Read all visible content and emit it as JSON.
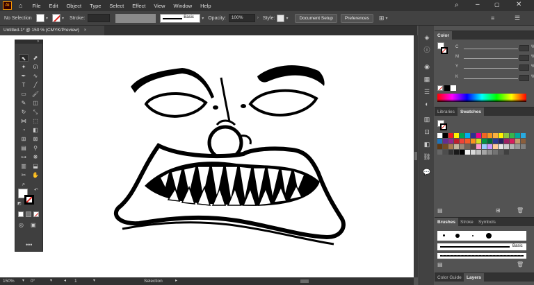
{
  "menubar": {
    "app_icon": "Ai",
    "items": [
      "File",
      "Edit",
      "Object",
      "Type",
      "Select",
      "Effect",
      "View",
      "Window",
      "Help"
    ]
  },
  "control_bar": {
    "selection_label": "No Selection",
    "stroke_label": "Stroke:",
    "brush_label": "Basic",
    "opacity_label": "Opacity:",
    "opacity_value": "100%",
    "style_label": "Style:",
    "document_setup": "Document Setup",
    "preferences": "Preferences"
  },
  "document_tab": {
    "title": "Untitled-1* @ 150 % (CMYK/Preview)",
    "close": "×"
  },
  "statusbar": {
    "zoom": "150%",
    "rotation": "0°",
    "artboard": "1",
    "tool": "Selection"
  },
  "color_panel": {
    "tab": "Color",
    "sliders": [
      {
        "label": "C",
        "unit": "%"
      },
      {
        "label": "M",
        "unit": "%"
      },
      {
        "label": "Y",
        "unit": "%"
      },
      {
        "label": "K",
        "unit": "%"
      }
    ]
  },
  "swatches_panel": {
    "tabs": [
      "Libraries",
      "Swatches"
    ],
    "colors": [
      "#ffffff",
      "#000000",
      "#ed1c24",
      "#fff200",
      "#00a651",
      "#00aeef",
      "#2e3192",
      "#ec008c",
      "#f26522",
      "#f7941d",
      "#fbb040",
      "#fff200",
      "#8dc63f",
      "#39b54a",
      "#00a99d",
      "#27aae1",
      "#1c75bc",
      "#662d91",
      "#92278f",
      "#be1e2d",
      "#ef4136",
      "#f15a29",
      "#f7931e",
      "#d7df23",
      "#009444",
      "#006838",
      "#2b388f",
      "#262262",
      "#9e1f63",
      "#d91c5c",
      "#c49a6c",
      "#8b5e3c",
      "#603913",
      "#754c24",
      "#a97c50",
      "#c2b59b",
      "#998675",
      "#736357",
      "#534741",
      "#ff99cc",
      "#99ccff",
      "#cc99ff",
      "#ffcc99",
      "#e6e6e6",
      "#cccccc",
      "#b3b3b3",
      "#999999",
      "#808080",
      "#666666",
      "#4d4d4d",
      "#333333",
      "#1a1a1a",
      "#000000",
      "#f2f2f2",
      "#d9d9d9",
      "#bfbfbf",
      "#a6a6a6",
      "#8c8c8c",
      "#737373",
      "#595959",
      "#404040"
    ]
  },
  "brushes_panel": {
    "tabs": [
      "Brushes",
      "Stroke",
      "Symbols"
    ],
    "basic_label": "Basic"
  },
  "bottom_tabs": [
    "Color Guide",
    "Layers"
  ]
}
